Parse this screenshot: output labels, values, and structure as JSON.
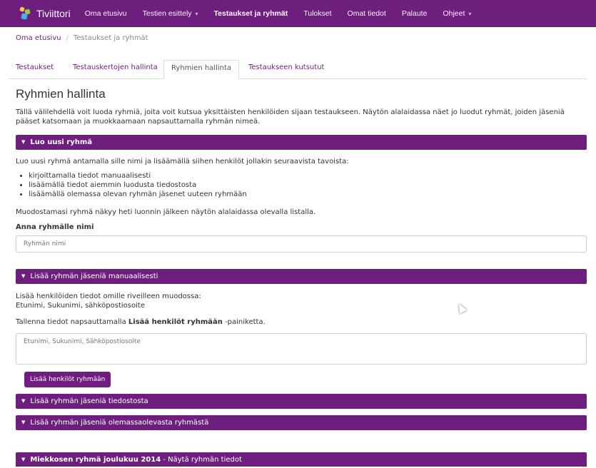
{
  "app": {
    "name": "Tiviittori"
  },
  "nav": {
    "items": [
      {
        "label": "Oma etusivu"
      },
      {
        "label": "Testien esittely",
        "caret": "▾"
      },
      {
        "label": "Testaukset ja ryhmät"
      },
      {
        "label": "Tulokset"
      },
      {
        "label": "Omat tiedot"
      },
      {
        "label": "Palaute"
      },
      {
        "label": "Ohjeet",
        "caret": "▾"
      }
    ]
  },
  "breadcrumb": {
    "home": "Oma etusivu",
    "separator": "/",
    "current": "Testaukset ja ryhmät"
  },
  "tabs": [
    {
      "label": "Testaukset"
    },
    {
      "label": "Testauskertojen hallinta"
    },
    {
      "label": "Ryhmien hallinta"
    },
    {
      "label": "Testaukseen kutsutut"
    }
  ],
  "page": {
    "title": "Ryhmien hallinta",
    "intro": "Tällä välilehdellä voit luoda ryhmiä, joita voit kutsua yksittäisten henkilöiden sijaan testaukseen. Näytön alalaidassa näet jo luodut ryhmät, joiden jäseniä pääset katsomaan ja muokkaamaan napsauttamalla ryhmän nimeä."
  },
  "create_group": {
    "header": "Luo uusi ryhmä",
    "description": "Luo uusi ryhmä antamalla sille nimi ja lisäämällä siihen henkilöt jollakin seuraavista tavoista:",
    "options": [
      "kirjoittamalla tiedot manuaalisesti",
      "lisäämällä tiedot aiemmin luodusta tiedostosta",
      "lisäämällä olemassa olevan ryhmän jäsenet uuteen ryhmään"
    ],
    "note": "Muodostamasi ryhmä näkyy heti luonnin jälkeen näytön alalaidassa olevalla listalla.",
    "name_label": "Anna ryhmälle nimi",
    "name_placeholder": "Ryhmän nimi"
  },
  "manual": {
    "header": "Lisää ryhmän jäseniä manuaalisesti",
    "instruction_line1": "Lisää henkilöiden tiedot omille riveilleen muodossa:",
    "instruction_line2": "Etunimi, Sukunimi, sähköpostiosoite",
    "save_prefix": "Tallenna tiedot napsauttamalla ",
    "save_bold": "Lisää henkilöt ryhmään",
    "save_suffix": " -painiketta.",
    "textarea_placeholder": "Etunimi, Sukunimi, Sähköpostiosoite",
    "button_label": "Lisää henkilöt ryhmään"
  },
  "from_file": {
    "header": "Lisää ryhmän jäseniä tiedostosta"
  },
  "from_group": {
    "header": "Lisää ryhmän jäseniä olemassaolevasta ryhmästä"
  },
  "existing_group": {
    "name": "Miekkosen ryhmä joulukuu 2014",
    "suffix": " - Näytä ryhmän tiedot"
  },
  "icons": {
    "chevron": "chevron-down-icon",
    "cursor": "mouse-pointer-icon"
  },
  "colors": {
    "brand": "#6e1e7d",
    "link": "#6e1e7d"
  }
}
